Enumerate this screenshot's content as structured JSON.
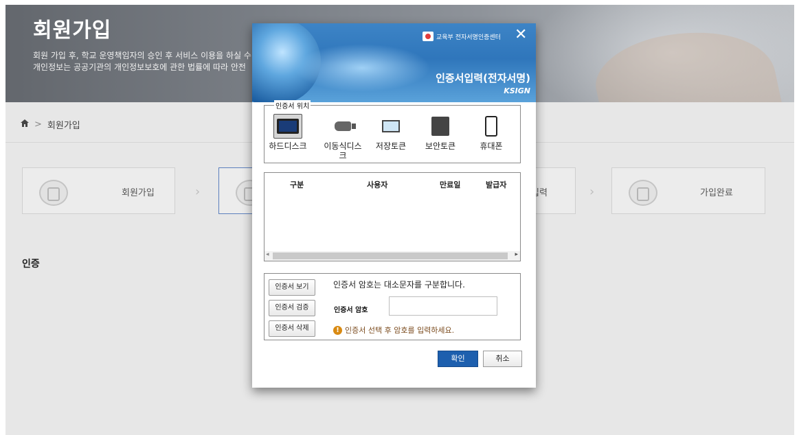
{
  "hero": {
    "title": "회원가입",
    "desc_line1": "회원 가입 후, 학교 운영책임자의 승인 후 서비스 이용을 하실 수",
    "desc_line2": "개인정보는 공공기관의 개인정보보호에 관한 법률에 따라 안전"
  },
  "breadcrumb": {
    "current": "회원가입"
  },
  "steps": [
    {
      "label": "회원가입"
    },
    {
      "label": ""
    },
    {
      "label": "입력"
    },
    {
      "label": "가입완료"
    }
  ],
  "section_title": "인증",
  "dialog": {
    "brand": "교육부 전자서명인증센터",
    "title": "인증서입력(전자서명)",
    "ksign": "KSIGN",
    "location_legend": "인증서 위치",
    "devices": [
      {
        "label": "하드디스크",
        "icon": "hard-disk-icon"
      },
      {
        "label": "이동식디스크",
        "icon": "usb-icon"
      },
      {
        "label": "저장토큰",
        "icon": "token-icon"
      },
      {
        "label": "보안토큰",
        "icon": "secure-token-icon"
      },
      {
        "label": "휴대폰",
        "icon": "phone-icon"
      }
    ],
    "table_headers": {
      "type": "구분",
      "user": "사용자",
      "expiry": "만료일",
      "issuer": "발급자"
    },
    "buttons": {
      "view": "인증서 보기",
      "verify": "인증서 검증",
      "delete": "인증서 삭제",
      "ok": "확인",
      "cancel": "취소"
    },
    "case_note": "인증서 암호는 대소문자를 구분합니다.",
    "password_label": "인증서 암호",
    "password_value": "",
    "warning": "인증서 선택 후 암호를 입력하세요."
  }
}
